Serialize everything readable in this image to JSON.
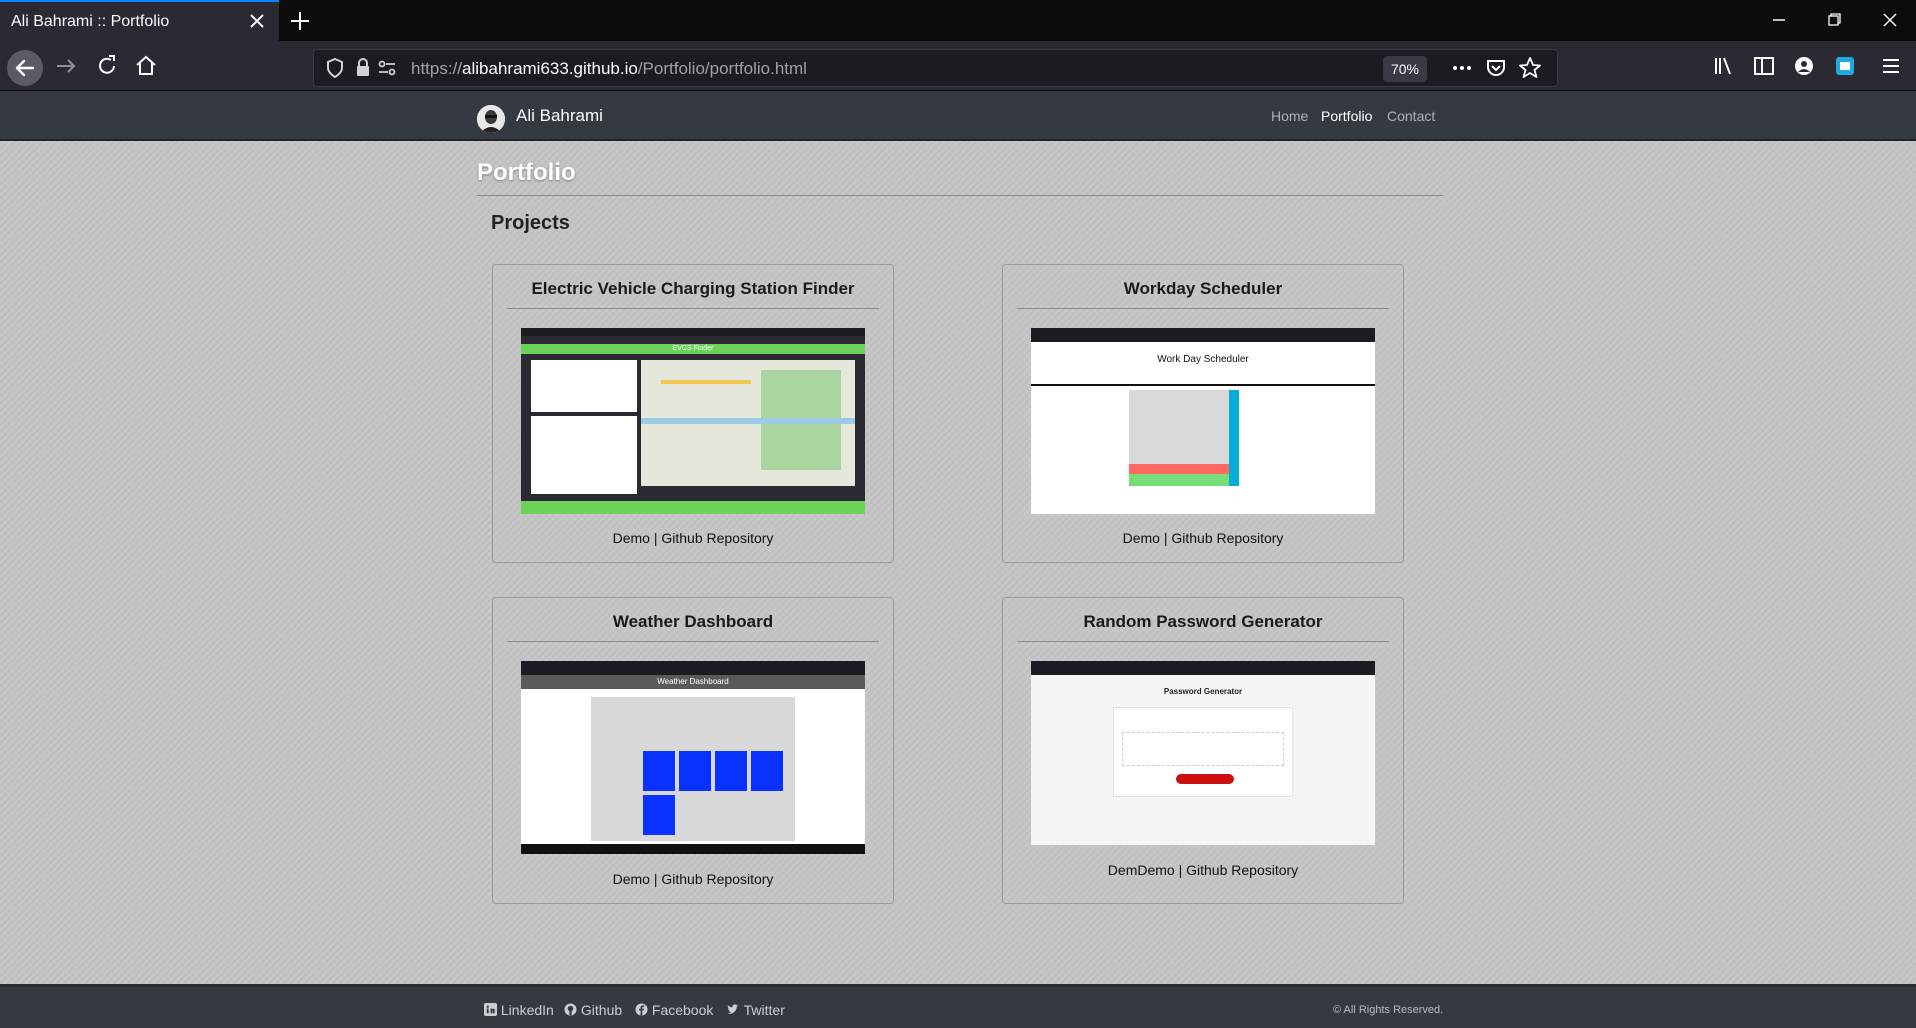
{
  "browser": {
    "tab_title": "Ali Bahrami :: Portfolio",
    "url_prefix": "https://",
    "url_domain": "alibahrami633.github.io",
    "url_path": "/Portfolio/portfolio.html",
    "zoom": "70%",
    "accent": "#0a84ff"
  },
  "site": {
    "brand": "Ali Bahrami",
    "nav": [
      "Home",
      "Portfolio",
      "Contact"
    ],
    "active_nav": "Portfolio",
    "page_title": "Portfolio",
    "section_title": "Projects"
  },
  "projects": [
    {
      "title": "Electric Vehicle Charging Station Finder",
      "demo": "Demo",
      "sep": " | ",
      "repo": "Github Repository",
      "screenshot_header": "EVCS Finder"
    },
    {
      "title": "Workday Scheduler",
      "demo": "Demo",
      "sep": " | ",
      "repo": "Github Repository",
      "screenshot_header": "Work Day Scheduler"
    },
    {
      "title": "Weather Dashboard",
      "demo": "Demo",
      "sep": " | ",
      "repo": "Github Repository",
      "screenshot_header": "Weather Dashboard"
    },
    {
      "title": "Random Password Generator",
      "demo": "DemDemo",
      "sep": " | ",
      "repo": "Github Repository",
      "screenshot_header": "Password Generator"
    }
  ],
  "footer": {
    "links": [
      "LinkedIn",
      "Github",
      "Facebook",
      "Twitter"
    ],
    "copyright": "© All Rights Reserved."
  }
}
